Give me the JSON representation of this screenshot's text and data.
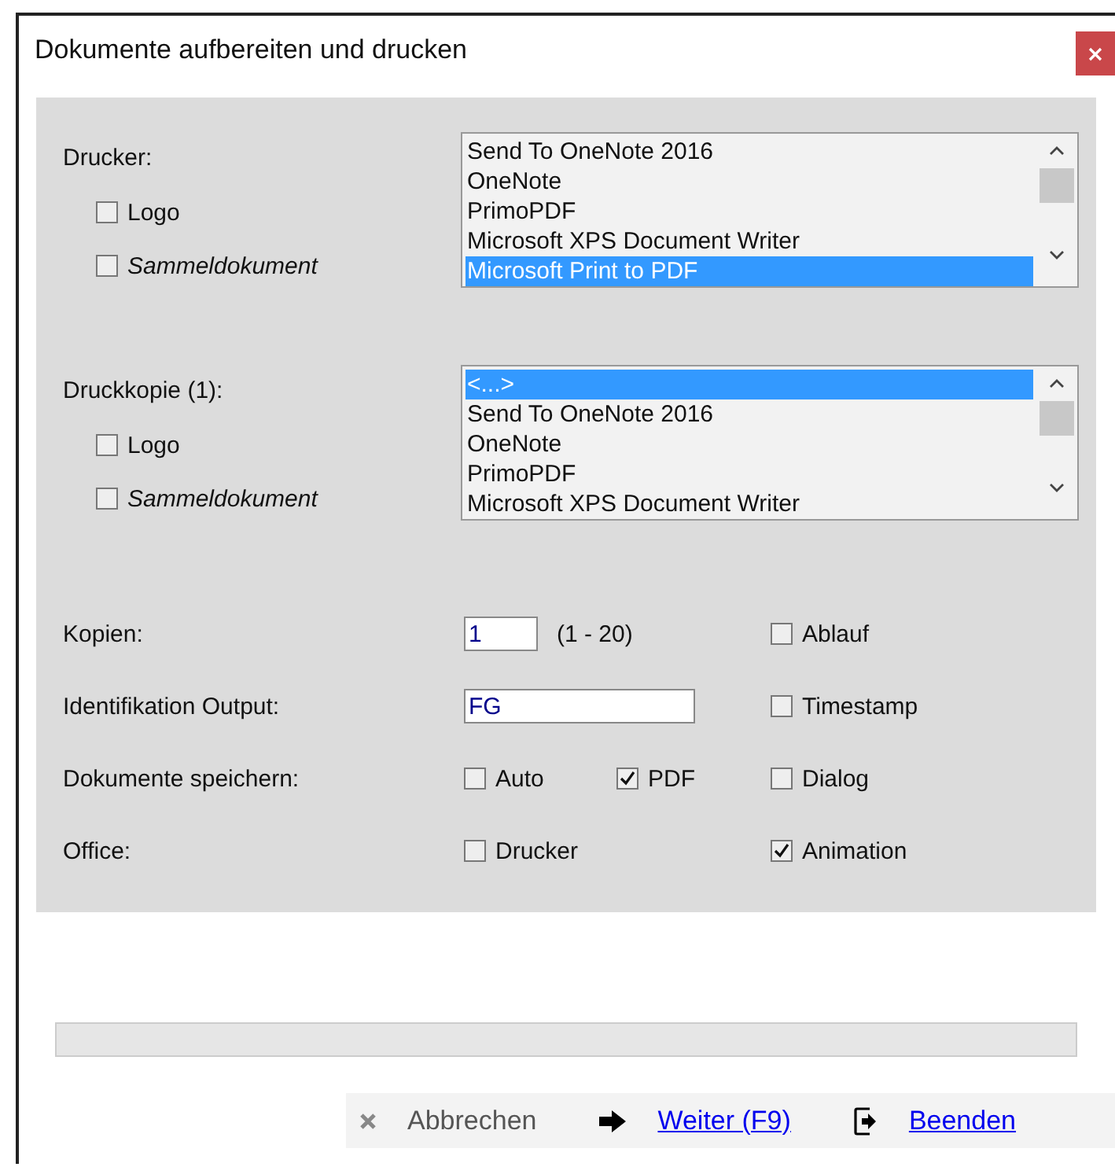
{
  "window": {
    "title": "Dokumente aufbereiten und drucken"
  },
  "printer_sections": [
    {
      "label": "Drucker:",
      "options": [
        {
          "label": "Logo",
          "checked": false,
          "italic": false
        },
        {
          "label": "Sammeldokument",
          "checked": false,
          "italic": true
        }
      ],
      "list": [
        {
          "label": "Send To OneNote 2016",
          "selected": false
        },
        {
          "label": "OneNote",
          "selected": false
        },
        {
          "label": "PrimoPDF",
          "selected": false
        },
        {
          "label": "Microsoft XPS Document Writer",
          "selected": false
        },
        {
          "label": "Microsoft Print to PDF",
          "selected": true
        }
      ]
    },
    {
      "label": "Druckkopie (1):",
      "options": [
        {
          "label": "Logo",
          "checked": false,
          "italic": false
        },
        {
          "label": "Sammeldokument",
          "checked": false,
          "italic": true
        }
      ],
      "list": [
        {
          "label": "<...>",
          "selected": true
        },
        {
          "label": "Send To OneNote 2016",
          "selected": false
        },
        {
          "label": "OneNote",
          "selected": false
        },
        {
          "label": "PrimoPDF",
          "selected": false
        },
        {
          "label": "Microsoft XPS Document Writer",
          "selected": false
        }
      ]
    }
  ],
  "settings": [
    {
      "label": "Kopien:",
      "controls": [
        {
          "kind": "short_input",
          "value": "1"
        },
        {
          "kind": "hint",
          "text": "(1 - 20)"
        }
      ],
      "right": {
        "label": "Ablauf",
        "checked": false
      }
    },
    {
      "label": "Identifikation Output:",
      "controls": [
        {
          "kind": "wide_input",
          "value": "FG"
        }
      ],
      "right": {
        "label": "Timestamp",
        "checked": false
      }
    },
    {
      "label": "Dokumente speichern:",
      "controls": [
        {
          "kind": "checkbox",
          "label": "Auto",
          "checked": false
        },
        {
          "kind": "checkbox",
          "label": "PDF",
          "checked": true
        }
      ],
      "right": {
        "label": "Dialog",
        "checked": false
      }
    },
    {
      "label": "Office:",
      "controls": [
        {
          "kind": "checkbox",
          "label": "Drucker",
          "checked": false
        }
      ],
      "right": {
        "label": "Animation",
        "checked": true
      }
    }
  ],
  "progress": {
    "level": 0
  },
  "footer": [
    {
      "kind": "cancel",
      "label": "Abbrechen",
      "disabled": true
    },
    {
      "kind": "next",
      "label": "Weiter (F9)",
      "disabled": false
    },
    {
      "kind": "exit",
      "label": "Beenden",
      "disabled": false
    }
  ]
}
